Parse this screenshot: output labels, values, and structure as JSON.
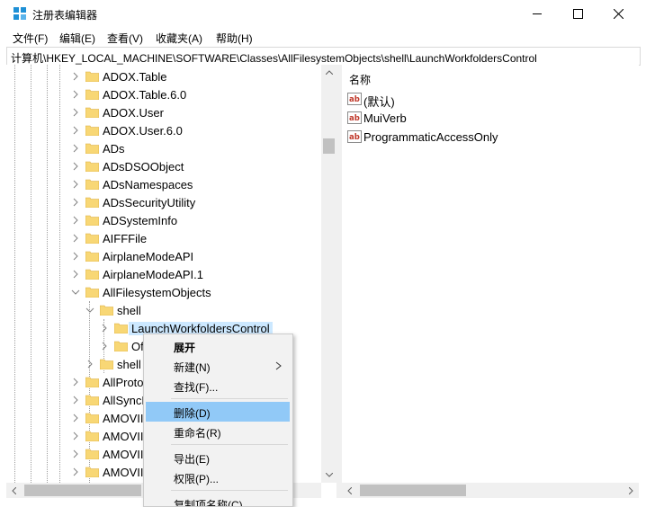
{
  "window": {
    "title": "注册表编辑器"
  },
  "menu": [
    "文件(F)",
    "编辑(E)",
    "查看(V)",
    "收藏夹(A)",
    "帮助(H)"
  ],
  "address": "计算机\\HKEY_LOCAL_MACHINE\\SOFTWARE\\Classes\\AllFilesystemObjects\\shell\\LaunchWorkfoldersControl",
  "tree": [
    {
      "label": "ADOX.Table"
    },
    {
      "label": "ADOX.Table.6.0"
    },
    {
      "label": "ADOX.User"
    },
    {
      "label": "ADOX.User.6.0"
    },
    {
      "label": "ADs"
    },
    {
      "label": "ADsDSOObject"
    },
    {
      "label": "ADsNamespaces"
    },
    {
      "label": "ADsSecurityUtility"
    },
    {
      "label": "ADSystemInfo"
    },
    {
      "label": "AIFFFile"
    },
    {
      "label": "AirplaneModeAPI"
    },
    {
      "label": "AirplaneModeAPI.1"
    },
    {
      "label": "AllFilesystemObjects"
    },
    {
      "label": "shell"
    },
    {
      "label": "LaunchWorkfoldersControl"
    },
    {
      "label": "Of"
    },
    {
      "label": "shell"
    },
    {
      "label": "AllProto"
    },
    {
      "label": "AllSyncR"
    },
    {
      "label": "AMOVII"
    },
    {
      "label": "AMOVII"
    },
    {
      "label": "AMOVII"
    },
    {
      "label": "AMOVII"
    }
  ],
  "values": {
    "column_header": "名称",
    "items": [
      "(默认)",
      "MuiVerb",
      "ProgrammaticAccessOnly"
    ]
  },
  "context_menu": {
    "items": [
      "展开",
      "新建(N)",
      "查找(F)...",
      "删除(D)",
      "重命名(R)",
      "导出(E)",
      "权限(P)...",
      "复制项名称(C)"
    ]
  },
  "colors": {
    "selection": "#cce8ff",
    "menu_highlight": "#91c9f7",
    "folder": "#f8d775"
  }
}
